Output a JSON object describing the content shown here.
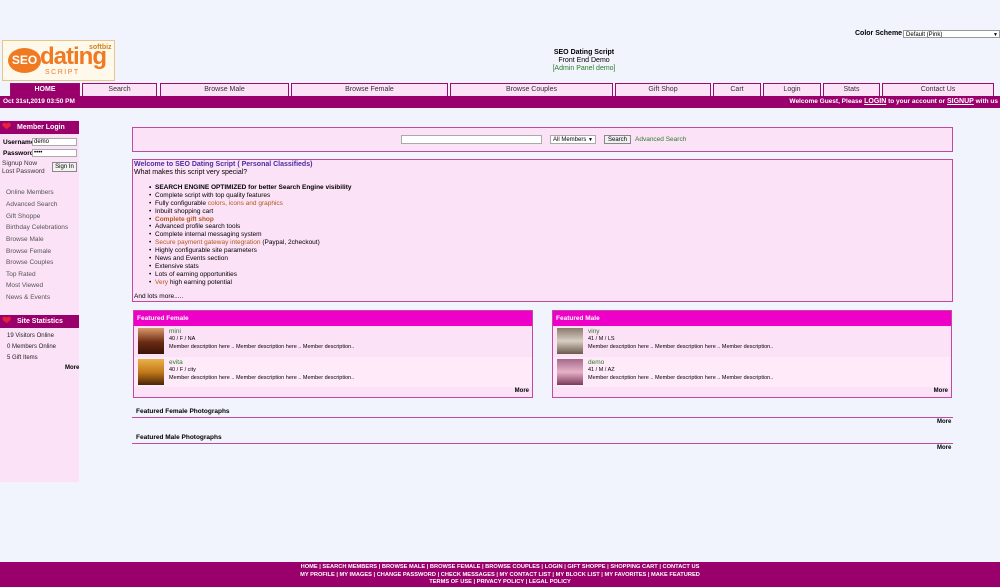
{
  "header": {
    "color_scheme_label": "Color Scheme :",
    "color_scheme_value": "Default (Pink)",
    "site_title": "SEO Dating Script",
    "site_subtitle": "Front End Demo",
    "admin_link": "[Admin Panel demo]",
    "logo": {
      "seo": "SEO",
      "dating": "dating",
      "softbiz": "softbiz",
      "script": "SCRIPT"
    }
  },
  "nav": {
    "tabs": [
      "HOME",
      "Search",
      "Browse Male",
      "Browse Female",
      "Browse Couples",
      "Gift Shop",
      "Cart",
      "Login",
      "Stats",
      "Contact Us"
    ]
  },
  "topbar": {
    "date": "Oct 31st,2019 03:50 PM",
    "welcome_prefix": "Welcome Guest, Please",
    "login": "LOGIN",
    "middle": "to your account or",
    "signup": "SIGNUP",
    "suffix": "with us"
  },
  "sidebar": {
    "login_title": "Member Login",
    "username_label": "Username",
    "username_value": "demo",
    "password_label": "Password",
    "password_value": "••••",
    "signup_link": "Signup Now",
    "lost_password_link": "Lost Password",
    "signin_button": "Sign In",
    "menu": [
      "Online Members",
      "Advanced Search",
      "Gift Shoppe",
      "Birthday Celebrations",
      "Browse Male",
      "Browse Female",
      "Browse Couples",
      "Top Rated",
      "Most Viewed",
      "News & Events"
    ],
    "stats_title": "Site Statistics",
    "stats": [
      "19 Visitors Online",
      "0 Members Online",
      "5 Gift Items"
    ],
    "stats_more": "More"
  },
  "search": {
    "select_value": "All Members",
    "button": "Search",
    "advanced_link": "Advanced Search"
  },
  "welcome": {
    "title": "Welcome to SEO Dating Script ( Personal Classifieds)",
    "subtitle": "What makes this script very special?",
    "features": [
      {
        "a": "SEARCH ENGINE OPTIMIZED for better Search Engine visibility",
        "b": "",
        "c": ""
      },
      {
        "a": "Complete script with top quality features",
        "b": "",
        "c": ""
      },
      {
        "a": "Fully configurable ",
        "b": "colors, icons and graphics",
        "c": ""
      },
      {
        "a": "Inbuilt shopping cart",
        "b": "",
        "c": ""
      },
      {
        "a": "",
        "b": "Complete gift shop",
        "c": ""
      },
      {
        "a": "Advanced profile search tools",
        "b": "",
        "c": ""
      },
      {
        "a": "Complete internal messaging system",
        "b": "",
        "c": ""
      },
      {
        "a": "",
        "b": "Secure payment gateway integration",
        "c": " (Paypal, 2checkout)"
      },
      {
        "a": "Highly configurable site parameters",
        "b": "",
        "c": ""
      },
      {
        "a": "News and Events section",
        "b": "",
        "c": ""
      },
      {
        "a": "Extensive stats",
        "b": "",
        "c": ""
      },
      {
        "a": "Lots of earning opportunities",
        "b": "",
        "c": ""
      },
      {
        "a": "",
        "b": "Very",
        "c": " high earning potential"
      }
    ],
    "more_text": "And lots more....."
  },
  "featured_female": {
    "title": "Featured Female",
    "members": [
      {
        "name": "mini",
        "meta": "40 / F / NA",
        "desc": "Member description here .. Member description here .. Member description.."
      },
      {
        "name": "evita",
        "meta": "40 / F / city",
        "desc": "Member description here .. Member description here .. Member description.."
      }
    ],
    "more": "More"
  },
  "featured_male": {
    "title": "Featured Male",
    "members": [
      {
        "name": "viny",
        "meta": "41 / M / LS",
        "desc": "Member description here .. Member description here .. Member description.."
      },
      {
        "name": "demo",
        "meta": "41 / M / AZ",
        "desc": "Member description here .. Member description here .. Member description.."
      }
    ],
    "more": "More"
  },
  "photos": {
    "female_title": "Featured Female Photographs",
    "male_title": "Featured Male Photographs",
    "more": "More"
  },
  "footer": {
    "line1": "HOME | SEARCH MEMBERS | BROWSE MALE | BROWSE FEMALE | BROWSE COUPLES | LOGIN | GIFT SHOPPE | SHOPPING CART | CONTACT US",
    "line2": "MY PROFILE | MY IMAGES | CHANGE PASSWORD | CHECK MESSAGES | MY CONTACT LIST | MY BLOCK LIST | MY FAVORITES | MAKE FEATURED",
    "line3": "TERMS OF USE | PRIVACY POLICY | LEGAL POLICY"
  },
  "colors": {
    "brand": "#99006b",
    "panel": "#fce2f6",
    "featured_header": "#ee00c9",
    "logo_orange": "#f07a22"
  },
  "icons": {
    "sidebar_heading": "heart-icon"
  }
}
